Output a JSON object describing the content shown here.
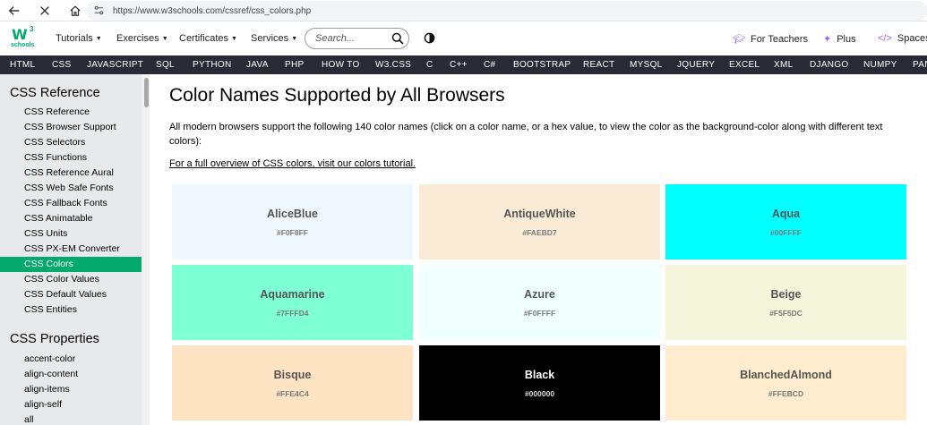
{
  "browser": {
    "url": "https://www.w3schools.com/cssref/css_colors.php"
  },
  "header": {
    "logo_main": "W",
    "logo_sup": "3",
    "logo_sub": "schools",
    "nav": [
      "Tutorials",
      "Exercises",
      "Certificates",
      "Services"
    ],
    "search_placeholder": "Search...",
    "for_teachers": "For Teachers",
    "plus": "Plus",
    "spaces": "Spaces"
  },
  "subject_nav": [
    "HTML",
    "CSS",
    "JAVASCRIPT",
    "SQL",
    "PYTHON",
    "JAVA",
    "PHP",
    "HOW TO",
    "W3.CSS",
    "C",
    "C++",
    "C#",
    "BOOTSTRAP",
    "REACT",
    "MYSQL",
    "JQUERY",
    "EXCEL",
    "XML",
    "DJANGO",
    "NUMPY",
    "PAN"
  ],
  "sidebar": {
    "heading1": "CSS Reference",
    "items1": [
      "CSS Reference",
      "CSS Browser Support",
      "CSS Selectors",
      "CSS Functions",
      "CSS Reference Aural",
      "CSS Web Safe Fonts",
      "CSS Fallback Fonts",
      "CSS Animatable",
      "CSS Units",
      "CSS PX-EM Converter",
      "CSS Colors",
      "CSS Color Values",
      "CSS Default Values",
      "CSS Entities"
    ],
    "active_item": "CSS Colors",
    "heading2": "CSS Properties",
    "items2": [
      "accent-color",
      "align-content",
      "align-items",
      "align-self",
      "all"
    ]
  },
  "main": {
    "title": "Color Names Supported by All Browsers",
    "intro": "All modern browsers support the following 140 color names (click on a color name, or a hex value, to view the color as the background-color along with different text colors):",
    "overview_link": "For a full overview of CSS colors, visit our colors tutorial.",
    "colors": [
      {
        "name": "AliceBlue",
        "hex": "#F0F8FF"
      },
      {
        "name": "AntiqueWhite",
        "hex": "#FAEBD7"
      },
      {
        "name": "Aqua",
        "hex": "#00FFFF"
      },
      {
        "name": "Aquamarine",
        "hex": "#7FFFD4"
      },
      {
        "name": "Azure",
        "hex": "#F0FFFF"
      },
      {
        "name": "Beige",
        "hex": "#F5F5DC"
      },
      {
        "name": "Bisque",
        "hex": "#FFE4C4"
      },
      {
        "name": "Black",
        "hex": "#000000"
      },
      {
        "name": "BlanchedAlmond",
        "hex": "#FFEBCD"
      }
    ]
  },
  "colors": {
    "accent": "#04aa6d",
    "subject_nav_bg": "#282a35",
    "sidebar_bg": "#e7e9eb"
  }
}
